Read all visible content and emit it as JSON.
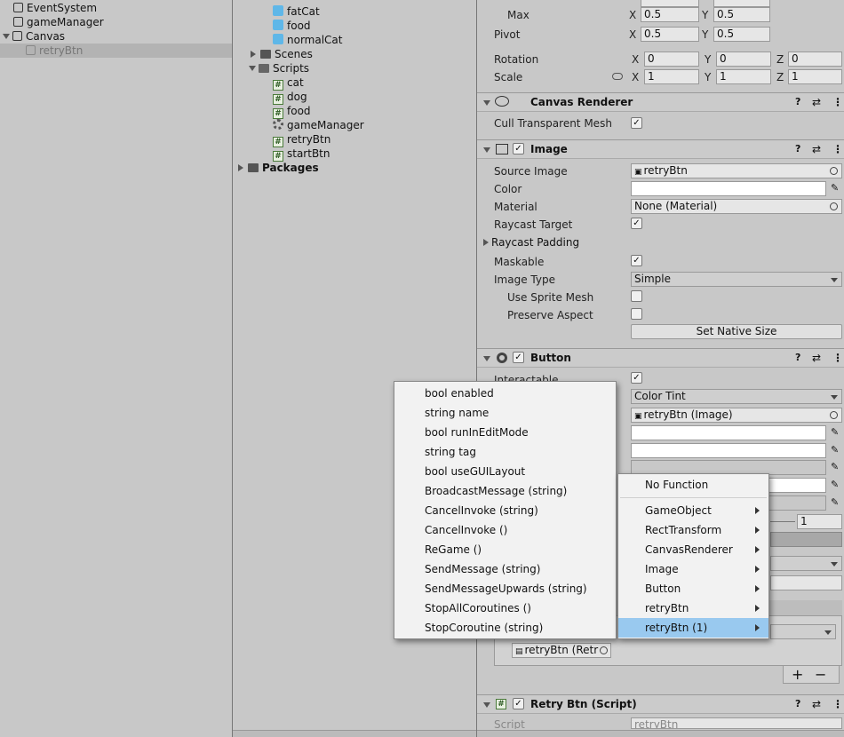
{
  "hierarchy": {
    "items": [
      {
        "label": "EventSystem"
      },
      {
        "label": "gameManager"
      },
      {
        "label": "Canvas"
      },
      {
        "label": "retryBtn"
      }
    ]
  },
  "project": {
    "items": [
      {
        "label": "fatCat"
      },
      {
        "label": "food"
      },
      {
        "label": "normalCat"
      },
      {
        "label": "Scenes"
      },
      {
        "label": "Scripts"
      },
      {
        "label": "cat"
      },
      {
        "label": "dog"
      },
      {
        "label": "food"
      },
      {
        "label": "gameManager"
      },
      {
        "label": "retryBtn"
      },
      {
        "label": "startBtn"
      },
      {
        "label": "Packages"
      }
    ]
  },
  "inspector": {
    "rect": {
      "max_label": "Max",
      "max_x": "0.5",
      "max_y": "0.5",
      "pivot_label": "Pivot",
      "pivot_x": "0.5",
      "pivot_y": "0.5",
      "rotation_label": "Rotation",
      "rot_x": "0",
      "rot_y": "0",
      "rot_z": "0",
      "scale_label": "Scale",
      "scale_x": "1",
      "scale_y": "1",
      "scale_z": "1",
      "axis_x": "X",
      "axis_y": "Y",
      "axis_z": "Z"
    },
    "canvas_renderer": {
      "title": "Canvas Renderer",
      "cull_label": "Cull Transparent Mesh",
      "cull_checked": "✓"
    },
    "image": {
      "title": "Image",
      "enabled_check": "✓",
      "source_label": "Source Image",
      "source_value": "retryBtn",
      "color_label": "Color",
      "material_label": "Material",
      "material_value": "None (Material)",
      "raycast_label": "Raycast Target",
      "raycast_checked": "✓",
      "padding_label": "Raycast Padding",
      "maskable_label": "Maskable",
      "maskable_checked": "✓",
      "type_label": "Image Type",
      "type_value": "Simple",
      "sprite_mesh_label": "Use Sprite Mesh",
      "preserve_label": "Preserve Aspect",
      "native_size_button": "Set Native Size"
    },
    "button": {
      "title": "Button",
      "enabled_check": "✓",
      "interactable_label": "Interactable",
      "interactable_checked": "✓",
      "transition_value": "Color Tint",
      "target_value": "retryBtn (Image)",
      "multiplier_value": "1",
      "onclick_object": "retryBtn (Retr",
      "plus": "+",
      "minus": "−"
    },
    "retry_script": {
      "title": "Retry Btn (Script)",
      "enabled_check": "✓",
      "script_label": "Script",
      "script_value": "retryBtn"
    }
  },
  "function_menu": {
    "items": [
      {
        "label": "No Function"
      },
      {
        "label": "GameObject"
      },
      {
        "label": "RectTransform"
      },
      {
        "label": "CanvasRenderer"
      },
      {
        "label": "Image"
      },
      {
        "label": "Button"
      },
      {
        "label": "retryBtn"
      },
      {
        "label": "retryBtn (1)"
      }
    ]
  },
  "method_menu": {
    "items": [
      {
        "label": "bool enabled"
      },
      {
        "label": "string name"
      },
      {
        "label": "bool runInEditMode"
      },
      {
        "label": "string tag"
      },
      {
        "label": "bool useGUILayout"
      },
      {
        "label": "BroadcastMessage (string)"
      },
      {
        "label": "CancelInvoke (string)"
      },
      {
        "label": "CancelInvoke ()"
      },
      {
        "label": "ReGame ()"
      },
      {
        "label": "SendMessage (string)"
      },
      {
        "label": "SendMessageUpwards (string)"
      },
      {
        "label": "StopAllCoroutines ()"
      },
      {
        "label": "StopCoroutine (string)"
      }
    ]
  }
}
